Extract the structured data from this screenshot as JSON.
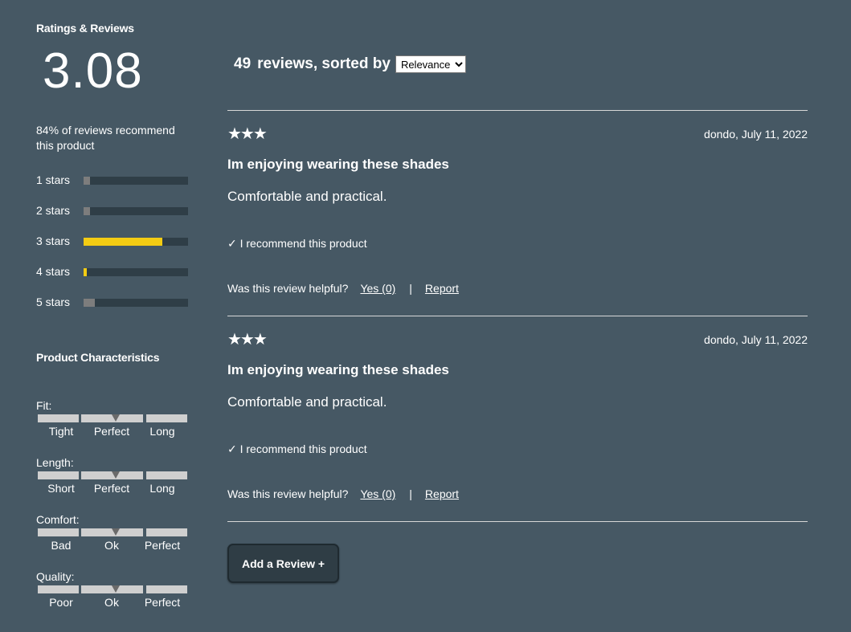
{
  "summary": {
    "title": "Ratings & Reviews",
    "average": "3.08",
    "recommend_text": "84% of reviews recommend this product"
  },
  "breakdown": [
    {
      "label": "1 stars",
      "fraction": 0.06,
      "color": "#7d7d7d"
    },
    {
      "label": "2 stars",
      "fraction": 0.06,
      "color": "#7d7d7d"
    },
    {
      "label": "3 stars",
      "fraction": 0.75,
      "color": "#f4cc13"
    },
    {
      "label": "4 stars",
      "fraction": 0.03,
      "color": "#f4cc13"
    },
    {
      "label": "5 stars",
      "fraction": 0.11,
      "color": "#7d7d7d"
    }
  ],
  "characteristics": {
    "title": "Product Characteristics",
    "items": [
      {
        "name": "Fit:",
        "labels": [
          "Tight",
          "Perfect",
          "Long"
        ]
      },
      {
        "name": "Length:",
        "labels": [
          "Short",
          "Perfect",
          "Long"
        ]
      },
      {
        "name": "Comfort:",
        "labels": [
          "Bad",
          "Ok",
          "Perfect"
        ]
      },
      {
        "name": "Quality:",
        "labels": [
          "Poor",
          "Ok",
          "Perfect"
        ]
      }
    ]
  },
  "list_header": {
    "count": "49",
    "sorted_text": "reviews, sorted by",
    "sort_value": "Relevance"
  },
  "reviews": [
    {
      "stars": "★★★",
      "meta": "dondo, July 11, 2022",
      "title": "Im enjoying wearing these shades",
      "body": "Comfortable and practical.",
      "recommend": "✓ I recommend this product",
      "helpful_q": "Was this review helpful?",
      "yes": "Yes (0)",
      "sep": "|",
      "report": "Report"
    },
    {
      "stars": "★★★",
      "meta": "dondo, July 11, 2022",
      "title": "Im enjoying wearing these shades",
      "body": "Comfortable and practical.",
      "recommend": "✓ I recommend this product",
      "helpful_q": "Was this review helpful?",
      "yes": "Yes (0)",
      "sep": "|",
      "report": "Report"
    }
  ],
  "add_review_label": "Add a Review +"
}
